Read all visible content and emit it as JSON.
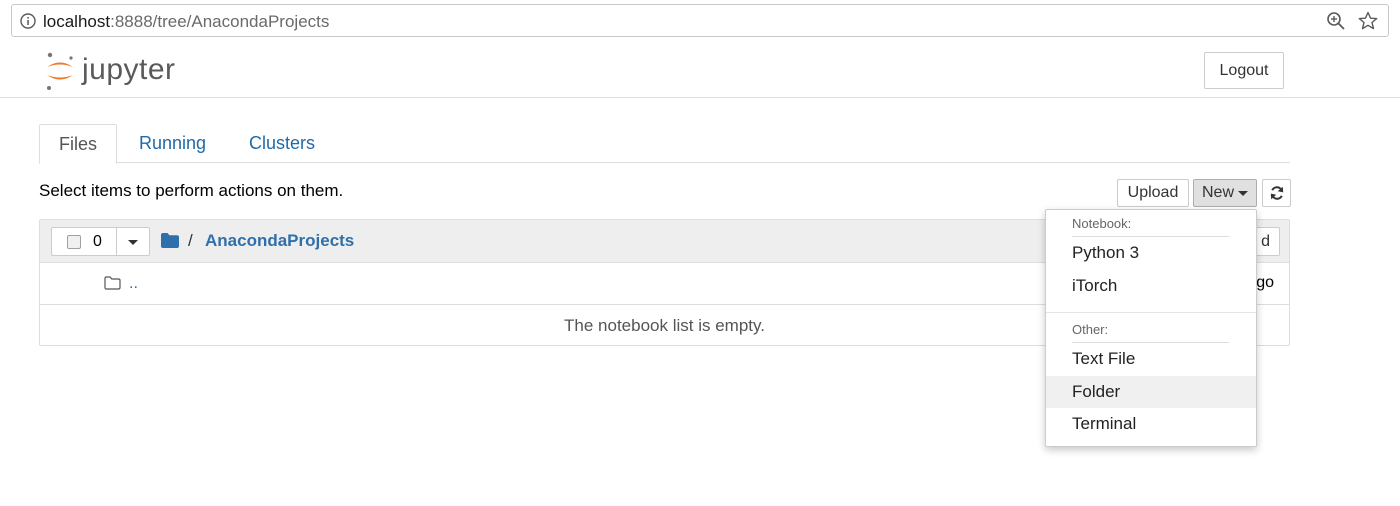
{
  "browser": {
    "url_host": "localhost",
    "url_path": ":8888/tree/AnacondaProjects",
    "icons": [
      "info-icon",
      "zoom-icon",
      "star-icon"
    ]
  },
  "header": {
    "logo_text": "jupyter",
    "logout_label": "Logout",
    "colors": {
      "logo_orange": "#f37726",
      "logo_gray": "#767677"
    }
  },
  "tabs": [
    {
      "label": "Files",
      "active": true
    },
    {
      "label": "Running",
      "active": false
    },
    {
      "label": "Clusters",
      "active": false
    }
  ],
  "toolbar": {
    "hint": "Select items to perform actions on them.",
    "upload_label": "Upload",
    "new_label": "New",
    "refresh_icon": "refresh-icon"
  },
  "filelist": {
    "selected_count": "0",
    "path_separator": "/",
    "path_link": "AnacondaProjects",
    "header_button_visible": "d",
    "parent_label": "..",
    "parent_modified_visible": "go",
    "empty_message": "The notebook list is empty.",
    "colors": {
      "link": "#2f6faa",
      "folder": "#2f6faa"
    }
  },
  "new_menu": {
    "notebook_header": "Notebook:",
    "notebook_items": [
      "Python 3",
      "iTorch"
    ],
    "other_header": "Other:",
    "other_items": [
      "Text File",
      "Folder",
      "Terminal"
    ],
    "highlighted": "Folder"
  }
}
